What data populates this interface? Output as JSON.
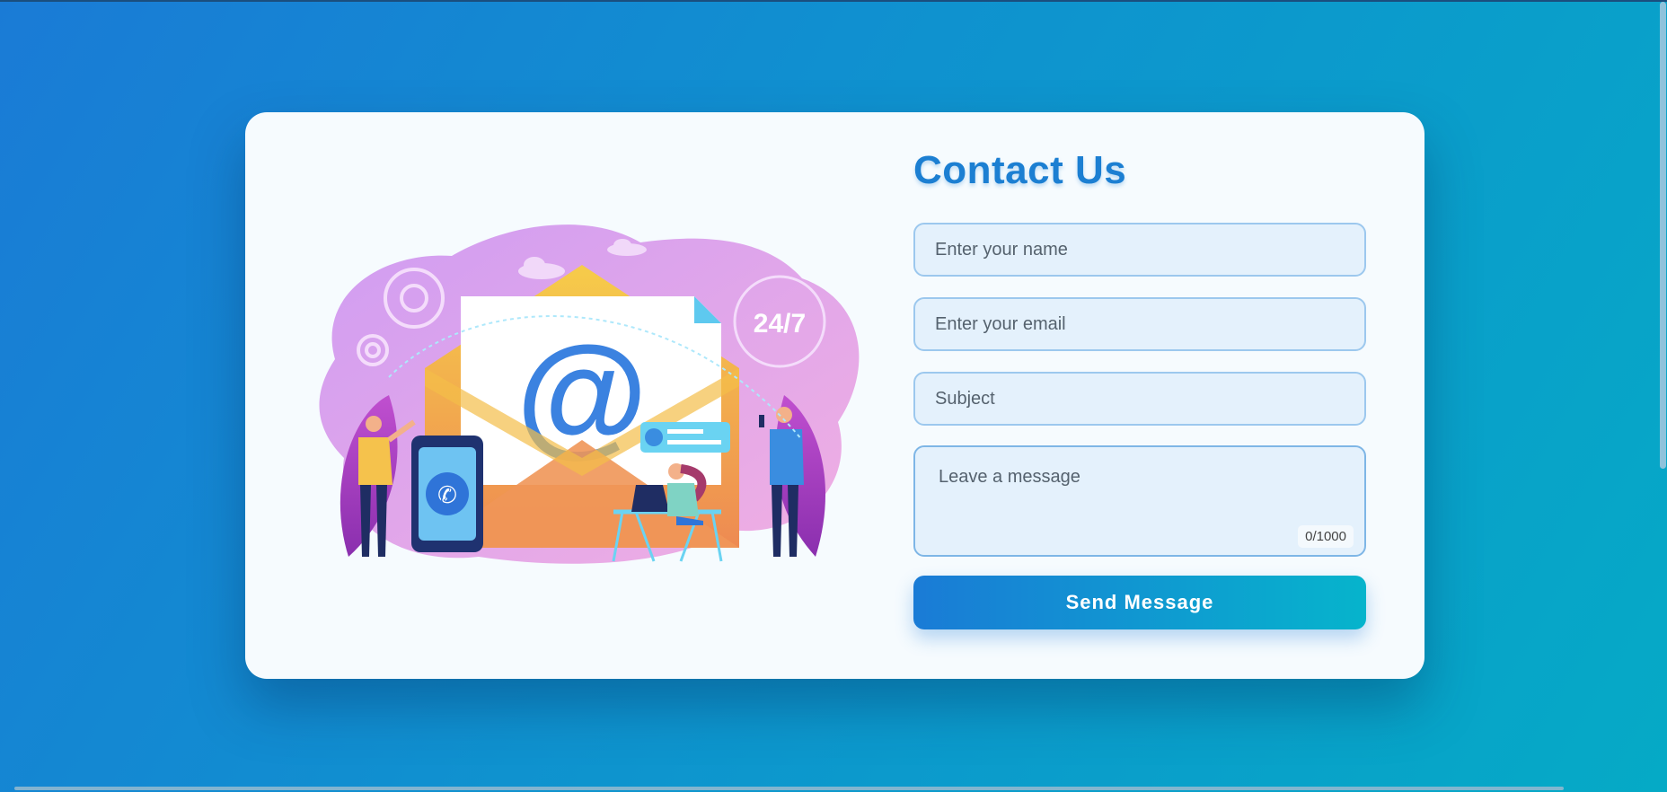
{
  "page": {
    "title": "Contact Us"
  },
  "form": {
    "name_placeholder": "Enter your name",
    "email_placeholder": "Enter your email",
    "subject_placeholder": "Subject",
    "message_placeholder": "Leave a message",
    "char_counter": "0/1000",
    "submit_label": "Send Message"
  },
  "illustration": {
    "badge_text": "24/7",
    "at_symbol": "@"
  },
  "colors": {
    "accent": "#1c7fd2",
    "button_start": "#1a7bd6",
    "button_end": "#06b4cc",
    "field_bg": "#e4f1fc"
  }
}
